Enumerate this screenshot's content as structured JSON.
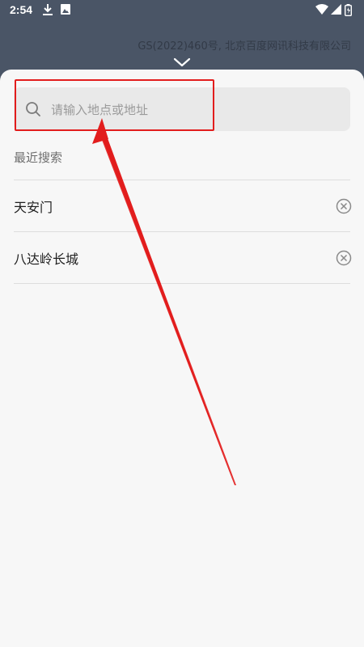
{
  "status_bar": {
    "time": "2:54",
    "icons": [
      "download-icon",
      "photo-icon",
      "wifi-icon",
      "signal-icon",
      "battery-icon"
    ]
  },
  "map": {
    "copyright": "GS(2022)460号, 北京百度网讯科技有限公司"
  },
  "search": {
    "placeholder": "请输入地点或地址",
    "value": ""
  },
  "recent": {
    "title": "最近搜索",
    "items": [
      {
        "label": "天安门"
      },
      {
        "label": "八达岭长城"
      }
    ]
  },
  "colors": {
    "header_bg": "#4a5566",
    "sheet_bg": "#f7f7f7",
    "search_bg": "#e9e9e9",
    "annotation_red": "#e21d1d"
  }
}
